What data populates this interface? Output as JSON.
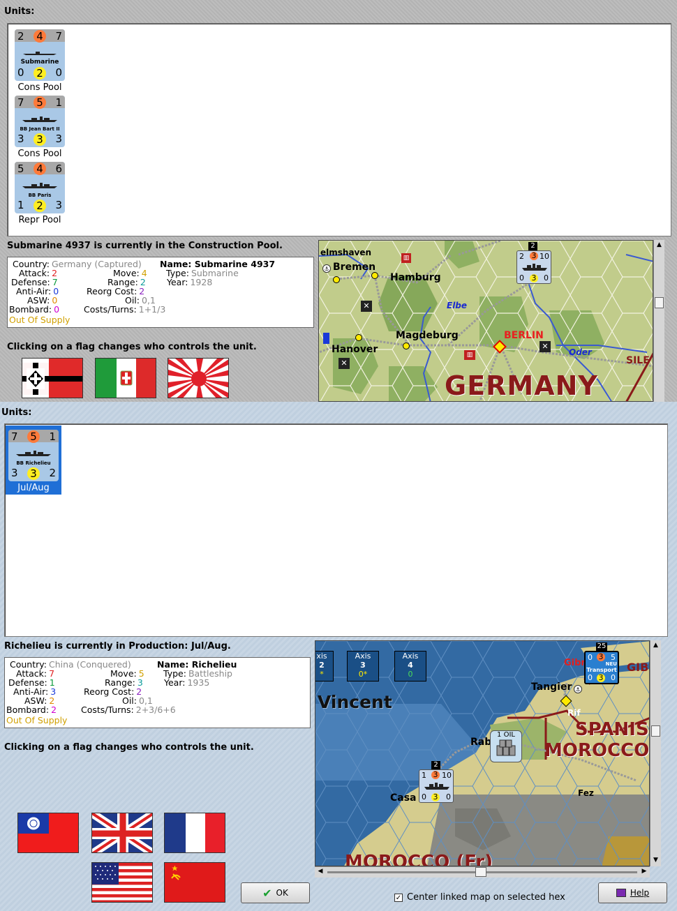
{
  "top_panel": {
    "units_label": "Units:",
    "units": [
      {
        "tl": "2",
        "tc": "4",
        "tr": "7",
        "name": "Submarine",
        "bl": "0",
        "bc": "2",
        "br": "0",
        "status": "Cons Pool"
      },
      {
        "tl": "7",
        "tc": "5",
        "tr": "1",
        "name": "BB Jean Bart II",
        "bl": "3",
        "bc": "3",
        "br": "3",
        "status": "Cons Pool"
      },
      {
        "tl": "5",
        "tc": "4",
        "tr": "6",
        "name": "BB Paris",
        "bl": "1",
        "bc": "2",
        "br": "3",
        "status": "Repr Pool"
      }
    ],
    "status_line": "Submarine 4937 is currently in the Construction Pool.",
    "info": {
      "country_label": "Country:",
      "country": "Germany (Captured)",
      "attack_label": "Attack:",
      "attack": "2",
      "defense_label": "Defense:",
      "defense": "7",
      "antiair_label": "Anti-Air:",
      "antiair": "0",
      "asw_label": "ASW:",
      "asw": "0",
      "bombard_label": "Bombard:",
      "bombard": "0",
      "supply": "Out Of Supply",
      "move_label": "Move:",
      "move": "4",
      "range_label": "Range:",
      "range": "2",
      "reorg_label": "Reorg Cost:",
      "reorg": "2",
      "oil_label": "Oil:",
      "oil": "0,1",
      "costs_label": "Costs/Turns:",
      "costs": "1+1/3",
      "name_label": "Name:",
      "name": "Submarine 4937",
      "type_label": "Type:",
      "type": "Submarine",
      "year_label": "Year:",
      "year": "1928"
    },
    "flag_hint": "Clicking on a flag changes who controls the unit.",
    "map": {
      "cities": [
        "elmshaven",
        "Bremen",
        "Hamburg",
        "Magdeburg",
        "Hanover",
        "BERLIN",
        "SILE"
      ],
      "rivers": [
        "Elbe",
        "Oder"
      ],
      "country_label": "GERMANY",
      "stack_count": "2",
      "stack_top": [
        "2",
        "3",
        "10"
      ],
      "stack_bottom": [
        "0",
        "3",
        "0"
      ]
    }
  },
  "bottom_panel": {
    "units_label": "Units:",
    "units": [
      {
        "tl": "7",
        "tc": "5",
        "tr": "1",
        "name": "BB Richelieu",
        "bl": "3",
        "bc": "3",
        "br": "2",
        "status": "Jul/Aug"
      }
    ],
    "status_line": "Richelieu is currently in Production: Jul/Aug.",
    "info": {
      "country_label": "Country:",
      "country": "China (Conquered)",
      "attack_label": "Attack:",
      "attack": "7",
      "defense_label": "Defense:",
      "defense": "1",
      "antiair_label": "Anti-Air:",
      "antiair": "3",
      "asw_label": "ASW:",
      "asw": "2",
      "bombard_label": "Bombard:",
      "bombard": "2",
      "supply": "Out Of Supply",
      "move_label": "Move:",
      "move": "5",
      "range_label": "Range:",
      "range": "3",
      "reorg_label": "Reorg Cost:",
      "reorg": "2",
      "oil_label": "Oil:",
      "oil": "0,1",
      "costs_label": "Costs/Turns:",
      "costs": "2+3/6+6",
      "name_label": "Name:",
      "name": "Richelieu",
      "type_label": "Type:",
      "type": "Battleship",
      "year_label": "Year:",
      "year": "1935"
    },
    "flag_hint": "Clicking on a flag changes who controls the unit.",
    "map": {
      "axis_boxes": [
        {
          "title": "xis",
          "value": "2",
          "sub": "*"
        },
        {
          "title": "Axis",
          "value": "3",
          "sub": "0*"
        },
        {
          "title": "Axis",
          "value": "4",
          "sub": "0"
        }
      ],
      "sea_label": "Vincent",
      "places": [
        "Gibr",
        "GIB",
        "Tangier",
        "Rif",
        "Rab",
        "Casa",
        "Fez"
      ],
      "region1": "SPANIS",
      "region2": "MOROCCO",
      "region3": "MOROCCO (Fr)",
      "oil_label": "1 OIL",
      "transport_label": "Transport",
      "transport_count": "25",
      "transport_top": [
        "0",
        "3",
        "5"
      ],
      "transport_bottom": [
        "0",
        "3",
        "0"
      ],
      "stack_count": "2",
      "stack_top": [
        "1",
        "3",
        "10"
      ],
      "stack_bottom": [
        "0",
        "3",
        "0"
      ],
      "neu_label": "NEU"
    },
    "ok_label": "OK",
    "center_checkbox_label": "Center linked map on selected hex",
    "help_label": "Help"
  }
}
